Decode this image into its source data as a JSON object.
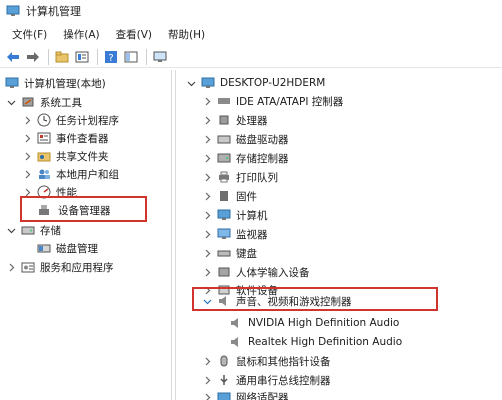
{
  "window": {
    "title": "计算机管理"
  },
  "menu": [
    "文件(F)",
    "操作(A)",
    "查看(V)",
    "帮助(H)"
  ],
  "toolbar": [
    "back-arrow-icon",
    "forward-arrow-icon",
    "folder-up-icon",
    "properties-icon",
    "help-icon",
    "panel-icon",
    "monitor-icon"
  ],
  "left_tree": {
    "root": "计算机管理(本地)",
    "system_tools": "系统工具",
    "task_scheduler": "任务计划程序",
    "event_viewer": "事件查看器",
    "shared_folders": "共享文件夹",
    "local_users": "本地用户和组",
    "performance": "性能",
    "device_manager": "设备管理器",
    "storage": "存储",
    "disk_management": "磁盘管理",
    "services_apps": "服务和应用程序"
  },
  "right_tree": {
    "computer": "DESKTOP-U2HDERM",
    "categories": [
      "IDE ATA/ATAPI 控制器",
      "处理器",
      "磁盘驱动器",
      "存储控制器",
      "打印队列",
      "固件",
      "计算机",
      "监视器",
      "键盘",
      "人体学输入设备",
      "软件设备",
      "声音、视频和游戏控制器",
      "NVIDIA High Definition Audio",
      "Realtek High Definition Audio",
      "鼠标和其他指针设备",
      "通用串行总线控制器",
      "网络适配器"
    ]
  },
  "colors": {
    "highlight": "#d0342c",
    "accent": "#1e73be"
  }
}
